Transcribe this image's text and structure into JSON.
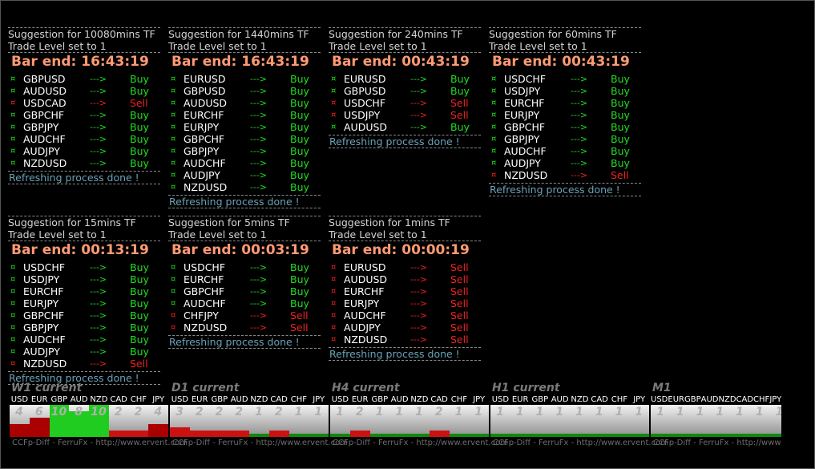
{
  "panels": [
    {
      "title": "Suggestion for 10080mins TF",
      "level": "Trade Level set to 1",
      "bar_end": "Bar end: 16:43:19",
      "rows": [
        [
          "GBPUSD",
          "Buy"
        ],
        [
          "AUDUSD",
          "Buy"
        ],
        [
          "USDCAD",
          "Sell"
        ],
        [
          "GBPCHF",
          "Buy"
        ],
        [
          "GBPJPY",
          "Buy"
        ],
        [
          "AUDCHF",
          "Buy"
        ],
        [
          "AUDJPY",
          "Buy"
        ],
        [
          "NZDUSD",
          "Buy"
        ]
      ],
      "status": "Refreshing process done !"
    },
    {
      "title": "Suggestion for 1440mins TF",
      "level": "Trade Level set to 1",
      "bar_end": "Bar end: 16:43:19",
      "rows": [
        [
          "EURUSD",
          "Buy"
        ],
        [
          "GBPUSD",
          "Buy"
        ],
        [
          "AUDUSD",
          "Buy"
        ],
        [
          "EURCHF",
          "Buy"
        ],
        [
          "EURJPY",
          "Buy"
        ],
        [
          "GBPCHF",
          "Buy"
        ],
        [
          "GBPJPY",
          "Buy"
        ],
        [
          "AUDCHF",
          "Buy"
        ],
        [
          "AUDJPY",
          "Buy"
        ],
        [
          "NZDUSD",
          "Buy"
        ]
      ],
      "status": "Refreshing process done !"
    },
    {
      "title": "Suggestion for 240mins TF",
      "level": "Trade Level set to 1",
      "bar_end": "Bar end: 00:43:19",
      "rows": [
        [
          "EURUSD",
          "Buy"
        ],
        [
          "GBPUSD",
          "Buy"
        ],
        [
          "USDCHF",
          "Sell"
        ],
        [
          "USDJPY",
          "Sell"
        ],
        [
          "AUDUSD",
          "Buy"
        ]
      ],
      "status": "Refreshing process done !"
    },
    {
      "title": "Suggestion for 60mins TF",
      "level": "Trade Level set to 1",
      "bar_end": "Bar end: 00:43:19",
      "rows": [
        [
          "USDCHF",
          "Buy"
        ],
        [
          "USDJPY",
          "Buy"
        ],
        [
          "EURCHF",
          "Buy"
        ],
        [
          "EURJPY",
          "Buy"
        ],
        [
          "GBPCHF",
          "Buy"
        ],
        [
          "GBPJPY",
          "Buy"
        ],
        [
          "AUDCHF",
          "Buy"
        ],
        [
          "AUDJPY",
          "Buy"
        ],
        [
          "NZDUSD",
          "Sell"
        ]
      ],
      "status": "Refreshing process done !"
    },
    {
      "title": "Suggestion for 15mins TF",
      "level": "Trade Level set to 1",
      "bar_end": "Bar end: 00:13:19",
      "rows": [
        [
          "USDCHF",
          "Buy"
        ],
        [
          "USDJPY",
          "Buy"
        ],
        [
          "EURCHF",
          "Buy"
        ],
        [
          "EURJPY",
          "Buy"
        ],
        [
          "GBPCHF",
          "Buy"
        ],
        [
          "GBPJPY",
          "Buy"
        ],
        [
          "AUDCHF",
          "Buy"
        ],
        [
          "AUDJPY",
          "Buy"
        ],
        [
          "NZDUSD",
          "Sell"
        ]
      ],
      "status": "Refreshing process done !"
    },
    {
      "title": "Suggestion for 5mins TF",
      "level": "Trade Level set to 1",
      "bar_end": "Bar end: 00:03:19",
      "rows": [
        [
          "USDCHF",
          "Buy"
        ],
        [
          "EURCHF",
          "Buy"
        ],
        [
          "GBPCHF",
          "Buy"
        ],
        [
          "AUDCHF",
          "Buy"
        ],
        [
          "CHFJPY",
          "Sell"
        ],
        [
          "NZDUSD",
          "Sell"
        ]
      ],
      "status": "Refreshing process done !"
    },
    {
      "title": "Suggestion for 1mins TF",
      "level": "Trade Level set to 1",
      "bar_end": "Bar end: 00:00:19",
      "rows": [
        [
          "EURUSD",
          "Sell"
        ],
        [
          "AUDUSD",
          "Sell"
        ],
        [
          "EURCHF",
          "Sell"
        ],
        [
          "EURJPY",
          "Sell"
        ],
        [
          "AUDCHF",
          "Sell"
        ],
        [
          "AUDJPY",
          "Sell"
        ],
        [
          "NZDUSD",
          "Sell"
        ]
      ],
      "status": "Refreshing process done !"
    }
  ],
  "arrow_text": "--->",
  "icon": "currency-sign-icon",
  "colors": {
    "buy": "#22dd22",
    "sell": "#ee2222",
    "bar_end": "#ff9a73",
    "refresh": "#6aa2b6"
  },
  "strength": {
    "currencies": [
      "USD",
      "EUR",
      "GBP",
      "AUD",
      "NZD",
      "CAD",
      "CHF",
      "JPY"
    ],
    "blocks": [
      {
        "label": "W1 current",
        "values": [
          4,
          6,
          10,
          8,
          10,
          2,
          2,
          4
        ]
      },
      {
        "label": "D1 current",
        "values": [
          3,
          2,
          2,
          2,
          1,
          2,
          1,
          1
        ]
      },
      {
        "label": "H4 current",
        "values": [
          1,
          2,
          1,
          1,
          1,
          2,
          1,
          1
        ]
      },
      {
        "label": "H1 current",
        "values": [
          1,
          1,
          1,
          1,
          1,
          1,
          1,
          1
        ]
      },
      {
        "label": "M1",
        "values": [
          1,
          1,
          1,
          1,
          1,
          1,
          1,
          1
        ]
      }
    ],
    "credit": "CCFp-Diff - FerruFx - http://www.ervent.com"
  }
}
